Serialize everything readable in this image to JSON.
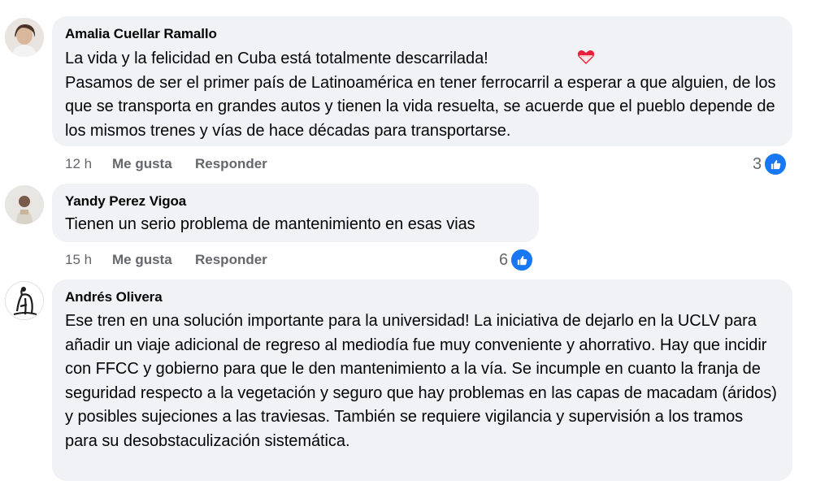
{
  "comments": [
    {
      "author": "Amalia Cuellar Ramallo",
      "text": "La vida y la felicidad en Cuba está totalmente descarrilada!\nPasamos de ser el primer país de Latinoamérica en tener ferrocarril a esperar a que alguien, de los que se transporta en grandes autos y tienen la vida resuelta, se acuerde que el pueblo depende de los mismos trenes y vías de hace décadas para transportarse.",
      "emoji": "heart-emoji",
      "time": "12 h",
      "like_label": "Me gusta",
      "reply_label": "Responder",
      "reaction_count": "3"
    },
    {
      "author": "Yandy Perez Vigoa",
      "text": "Tienen un serio problema de mantenimiento en esas vias",
      "time": "15 h",
      "like_label": "Me gusta",
      "reply_label": "Responder",
      "reaction_count": "6"
    },
    {
      "author": "Andrés Olivera",
      "text": "Ese tren en una solución importante para la universidad! La iniciativa de dejarlo en la UCLV para añadir un viaje adicional de regreso al mediodía fue muy conveniente y ahorrativo. Hay que incidir con FFCC y gobierno para que le den mantenimiento a la vía. Se incumple en cuanto la franja de seguridad respecto a la vegetación y seguro que hay problemas en las capas de macadam (áridos) y posibles sujeciones a las traviesas. También se requiere vigilancia y supervisión a los tramos para su desobstaculización sistemática."
    }
  ],
  "colors": {
    "bubble": "#f0f2f5",
    "meta_text": "#65676b",
    "like_blue": "#1877f2"
  }
}
